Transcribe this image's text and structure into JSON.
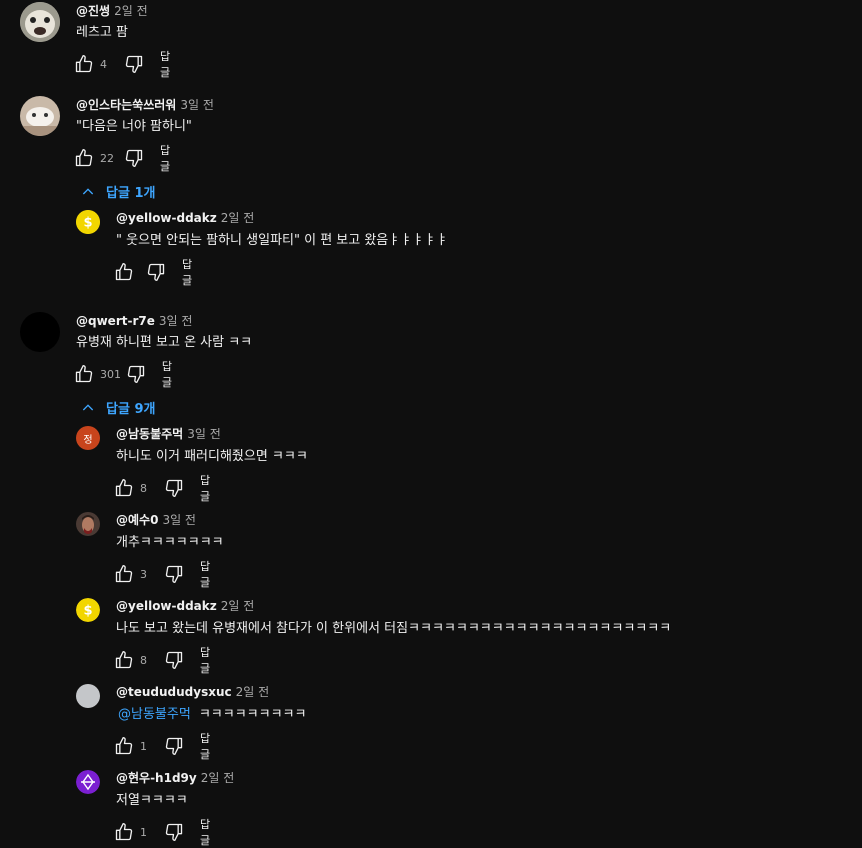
{
  "comments": [
    {
      "author": "@진썽",
      "time": "2일 전",
      "text": "레츠고 팜",
      "likes": "4",
      "reply_label": "답글"
    },
    {
      "author": "@인스타는쑥쓰러워",
      "time": "3일 전",
      "text": "\"다음은 너야 팜하니\"",
      "likes": "22",
      "reply_label": "답글",
      "replies_toggle": "답글 1개",
      "replies": [
        {
          "author": "@yellow-ddakz",
          "time": "2일 전",
          "text": "\" 웃으면 안되는 팜하니 생일파티\" 이 편 보고 왔음ㅑㅑㅑㅑㅑ",
          "likes": "",
          "reply_label": "답글"
        }
      ]
    },
    {
      "author": "@qwert-r7e",
      "time": "3일 전",
      "text": "유병재 하니편 보고 온 사람 ㅋㅋ",
      "likes": "301",
      "reply_label": "답글",
      "replies_toggle": "답글 9개",
      "replies": [
        {
          "author": "@남동불주먹",
          "time": "3일 전",
          "avatar_letter": "정",
          "text": "하니도 이거 패러디해줬으면 ㅋㅋㅋ",
          "likes": "8",
          "reply_label": "답글"
        },
        {
          "author": "@예수0",
          "time": "3일 전",
          "text": "개추ㅋㅋㅋㅋㅋㅋㅋ",
          "likes": "3",
          "reply_label": "답글"
        },
        {
          "author": "@yellow-ddakz",
          "time": "2일 전",
          "text": "나도 보고 왔는데 유병재에서 참다가 이 한위에서 터짐ㅋㅋㅋㅋㅋㅋㅋㅋㅋㅋㅋㅋㅋㅋㅋㅋㅋㅋㅋㅋㅋㅋ",
          "likes": "8",
          "reply_label": "답글"
        },
        {
          "author": "@teudududysxuc",
          "time": "2일 전",
          "mention": "@남동불주먹",
          "text": "ㅋㅋㅋㅋㅋㅋㅋㅋㅋ",
          "likes": "1",
          "reply_label": "답글"
        },
        {
          "author": "@현우-h1d9y",
          "time": "2일 전",
          "text": "저열ㅋㅋㅋㅋ",
          "likes": "1",
          "reply_label": "답글"
        }
      ]
    }
  ],
  "colors": {
    "background": "#0f0f0f",
    "text": "#f1f1f1",
    "secondary_text": "#aaaaaa",
    "link_blue": "#3ea6ff"
  }
}
